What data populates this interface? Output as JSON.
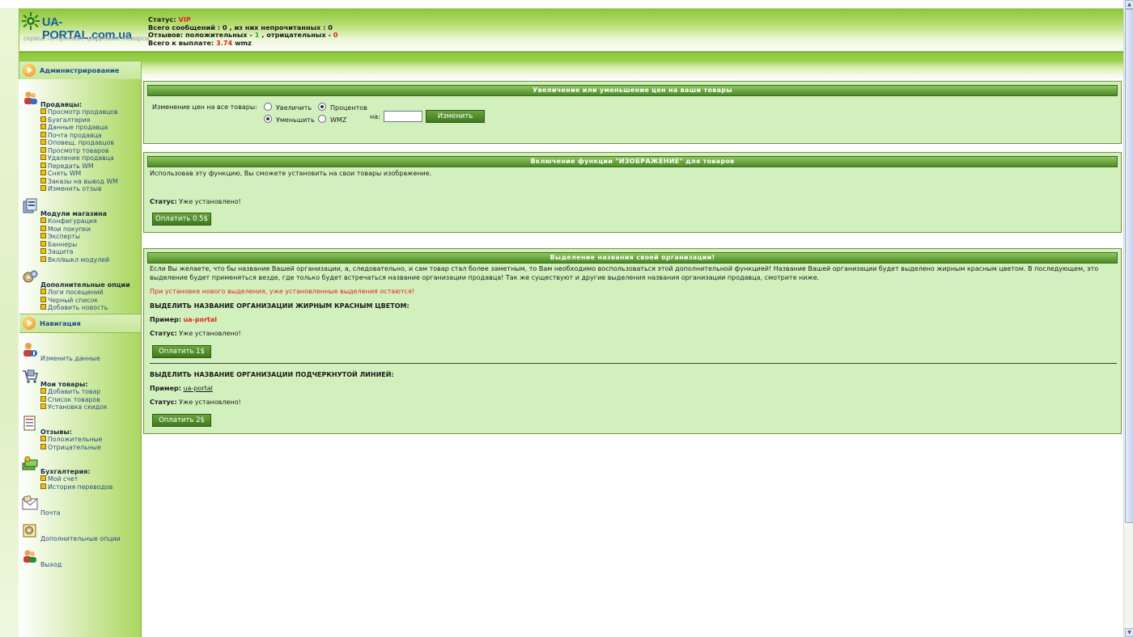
{
  "header": {
    "logo_title": "UA-PORTAL.com.ua",
    "logo_sub": "сервис по продаже цифровых товаров",
    "status_label": "Статус:",
    "status_value": "VIP",
    "messages": "Всего сообщений : 0 , из них непрочитанных : 0",
    "reviews_prefix": "Отзывов: положительных -",
    "reviews_pos": "1",
    "reviews_mid": ", отрицательных -",
    "reviews_neg": "0",
    "payout_prefix": "Всего к выплате:",
    "payout_value": "3.74",
    "payout_unit": "wmz"
  },
  "admin_bar": {
    "label": "Администрирование"
  },
  "sidebar": {
    "sellers_title": "Продавцы:",
    "sellers_items": [
      "Просмотр продавцов",
      "Бухгалтерия",
      "Данные продавца",
      "Почта продавца",
      "Оповещ. продавцов",
      "Просмотр товаров",
      "Удаление продавца",
      "Передать WM",
      "Снять WM",
      "Заказы на вывод WM",
      "Изменить отзыв"
    ],
    "modules_title": "Модули магазина",
    "modules_items": [
      "Конфигурация",
      "Мои покупки",
      "Эксперты",
      "Баннеры",
      "Защита",
      "Вкл/выкл модулей"
    ],
    "extra_title": "Дополнительные опции",
    "extra_items": [
      "Логи посещений",
      "Черный список",
      "Добавить новость"
    ],
    "nav_label": "Навигация",
    "change_data": "Изменить данные",
    "goods_title": "Мои товары:",
    "goods_items": [
      "Добавить товар",
      "Список товаров",
      "Установка скидок"
    ],
    "reviews_title": "Отзывы:",
    "reviews_items": [
      "Положительные",
      "Отрицательные"
    ],
    "accounting_title": "Бухгалтерия:",
    "accounting_items": [
      "Мой счет",
      "История переводов"
    ],
    "mail": "Почта",
    "extra_options": "Дополнительные опции",
    "exit": "Выход"
  },
  "panel_price": {
    "title": "Увеличение или уменьшение цен на ваши товары",
    "label": "Изменение цен на все товары:",
    "opt_increase": "Увеличить",
    "opt_decrease": "Уменьшить",
    "opt_percent": "Процентов",
    "opt_wmz": "WMZ",
    "on_label": "на:",
    "input_value": "",
    "button": "Изменить"
  },
  "panel_image": {
    "title": "Включение функции \"ИЗОБРАЖЕНИЕ\" для товаров",
    "desc": "Использовав эту функцию, Вы сможете установить на свои товары изображение.",
    "status_label": "Статус:",
    "status_value": "Уже установлено!",
    "button": "Оплатить 0.5$"
  },
  "panel_org": {
    "title": "Выделение названия своей организации!",
    "desc": "Если Вы желаете, что бы название Вашей организации, а, следовательно, и сам товар стал более заметным, то Вам необходимо воспользоваться этой дополнительной функцией! Название Вашей организации будет выделено жирным красным цветом. В последующем, это выделение будет применяться везде, где только будет встречаться название организации продавца! Так же существуют и другие выделения названия организации продавца, смотрите ниже.",
    "warning": "При установке нового выделения, уже установленные выделения остаются!",
    "bold_heading": "ВЫДЕЛИТЬ НАЗВАНИЕ ОРГАНИЗАЦИИ ЖИРНЫМ КРАСНЫМ ЦВЕТОМ:",
    "example_label": "Пример:",
    "example_bold": "ua-portal",
    "status_label": "Статус:",
    "status_value": "Уже установлено!",
    "button_bold": "Оплатить 1$",
    "underline_heading": "ВЫДЕЛИТЬ НАЗВАНИЕ ОРГАНИЗАЦИИ ПОДЧЕРКНУТОЙ ЛИНИЕЙ:",
    "example_underline": "ua-portal",
    "button_underline": "Оплатить 2$"
  },
  "colors": {
    "accent_green": "#4e8a2a",
    "panel_bg": "#d2f0bd",
    "status_red": "#e0261a"
  }
}
